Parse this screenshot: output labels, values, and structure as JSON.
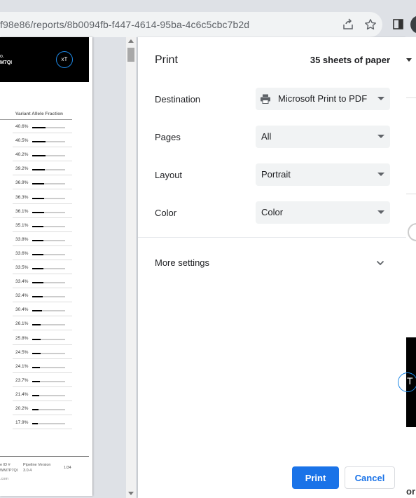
{
  "browser": {
    "url": "f98e86/reports/8b0094fb-f447-4614-95ba-4c6c5cbc7b2d",
    "icons": [
      "share-icon",
      "bookmark-star-icon",
      "sidebar-icon"
    ]
  },
  "print_dialog": {
    "title": "Print",
    "sheets": "35 sheets of paper",
    "destination": {
      "label": "Destination",
      "value": "Microsoft Print to PDF",
      "icon": "printer-icon"
    },
    "pages": {
      "label": "Pages",
      "value": "All"
    },
    "layout": {
      "label": "Layout",
      "value": "Portrait"
    },
    "color": {
      "label": "Color",
      "value": "Color"
    },
    "more_settings": "More settings",
    "print_button": "Print",
    "cancel_button": "Cancel",
    "accent_color": "#1a73e8"
  },
  "preview": {
    "header_line1": "o.",
    "header_line2": "M7QI",
    "logo_text": "xT",
    "column_header": "Variant Allele Fraction",
    "vaf_values": [
      "40.6%",
      "40.5%",
      "40.2%",
      "39.2%",
      "36.9%",
      "36.3%",
      "36.1%",
      "35.1%",
      "33.8%",
      "33.6%",
      "33.5%",
      "33.4%",
      "32.4%",
      "30.4%",
      "26.1%",
      "25.8%",
      "24.5%",
      "24.1%",
      "23.7%",
      "21.4%",
      "20.2%",
      "17.9%"
    ],
    "vaf_fractions": [
      0.406,
      0.405,
      0.402,
      0.392,
      0.369,
      0.363,
      0.361,
      0.351,
      0.338,
      0.336,
      0.335,
      0.334,
      0.324,
      0.304,
      0.261,
      0.258,
      0.245,
      0.241,
      0.237,
      0.214,
      0.202,
      0.179
    ],
    "footer_sample_label": "e ID #",
    "footer_sample_value": "WM7P7QI",
    "footer_pipeline_label": "Pipeline Version",
    "footer_pipeline_value": "3.0.4",
    "footer_page": "1/34",
    "footer_site": ".com"
  },
  "background": {
    "logo_letter": "T",
    "text_fragment": "or"
  }
}
